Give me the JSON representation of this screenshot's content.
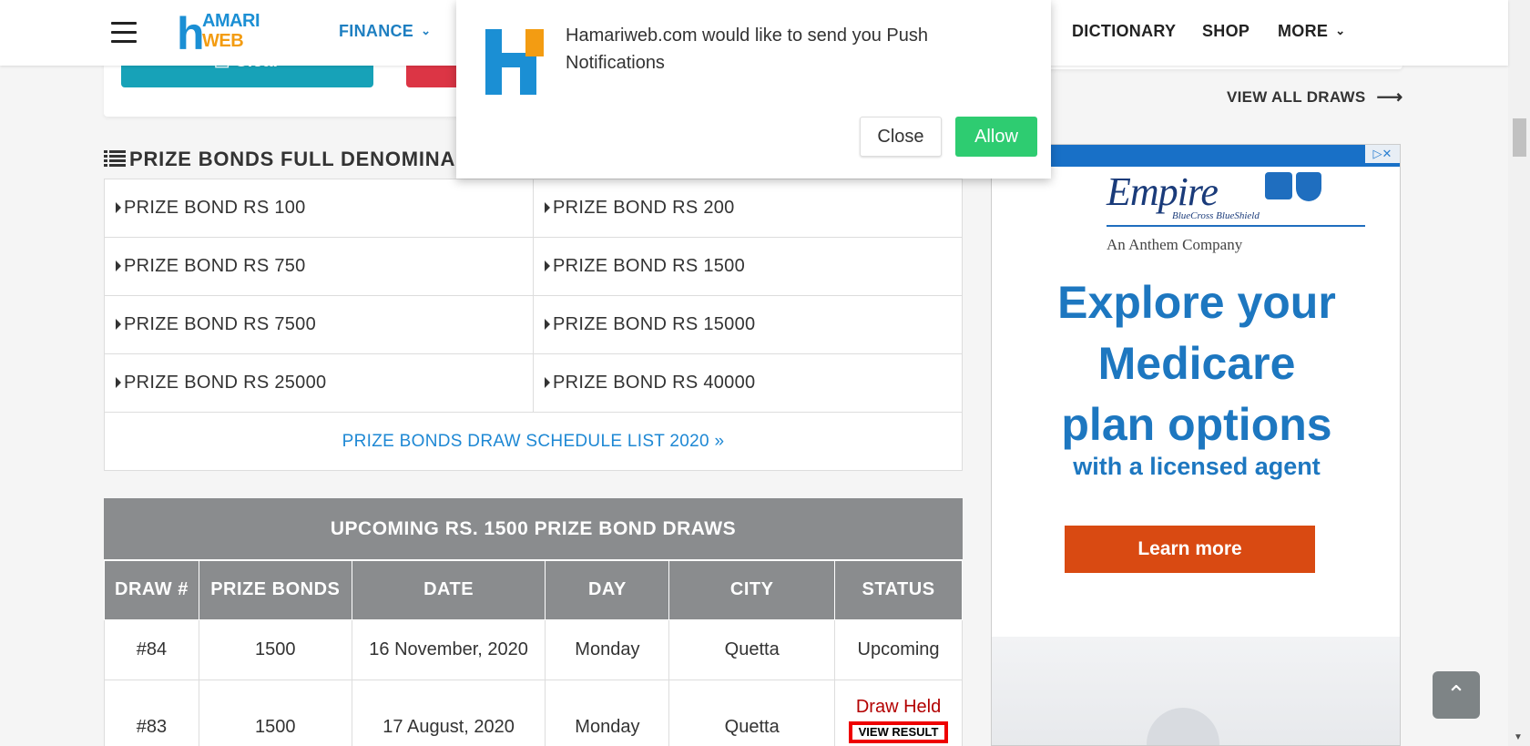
{
  "header": {
    "logo_text_1": "AMARI",
    "logo_text_2": "WEB",
    "nav_finance": "FINANCE",
    "nav_dictionary": "DICTIONARY",
    "nav_shop": "SHOP",
    "nav_more": "MORE"
  },
  "top_card": {
    "clear_label": "Clear"
  },
  "section_title": "PRIZE BONDS FULL DENOMINA",
  "denominations": [
    [
      "PRIZE BOND RS 100",
      "PRIZE BOND RS 200"
    ],
    [
      "PRIZE BOND RS 750",
      "PRIZE BOND RS 1500"
    ],
    [
      "PRIZE BOND RS 7500",
      "PRIZE BOND RS 15000"
    ],
    [
      "PRIZE BOND RS 25000",
      "PRIZE BOND RS 40000"
    ]
  ],
  "schedule_link": "PRIZE BONDS DRAW SCHEDULE LIST 2020",
  "draws": {
    "caption": "UPCOMING RS. 1500 PRIZE BOND DRAWS",
    "headers": [
      "DRAW #",
      "PRIZE BONDS",
      "DATE",
      "DAY",
      "CITY",
      "STATUS"
    ],
    "rows": [
      {
        "draw": "#84",
        "bonds": "1500",
        "date": "16 November, 2020",
        "day": "Monday",
        "city": "Quetta",
        "status": "Upcoming"
      },
      {
        "draw": "#83",
        "bonds": "1500",
        "date": "17 August, 2020",
        "day": "Monday",
        "city": "Quetta",
        "status": "Draw Held",
        "action": "VIEW RESULT"
      }
    ]
  },
  "right": {
    "view_all": "VIEW ALL DRAWS"
  },
  "ad": {
    "brand": "Empire",
    "brand_sub": "BlueCross BlueShield",
    "company": "An Anthem Company",
    "headline_1": "Explore your",
    "headline_2": "Medicare",
    "headline_3": "plan options",
    "sub": "with a licensed agent",
    "cta": "Learn more"
  },
  "popup": {
    "message": "Hamariweb.com would like to send you Push Notifications",
    "close_label": "Close",
    "allow_label": "Allow"
  },
  "colors": {
    "brand_blue": "#1e7fc1",
    "table_header": "#8a8c8e",
    "upcoming": "#1f9d1f",
    "held": "#b30000",
    "allow_green": "#2ecc71",
    "ad_orange": "#d94a12"
  }
}
